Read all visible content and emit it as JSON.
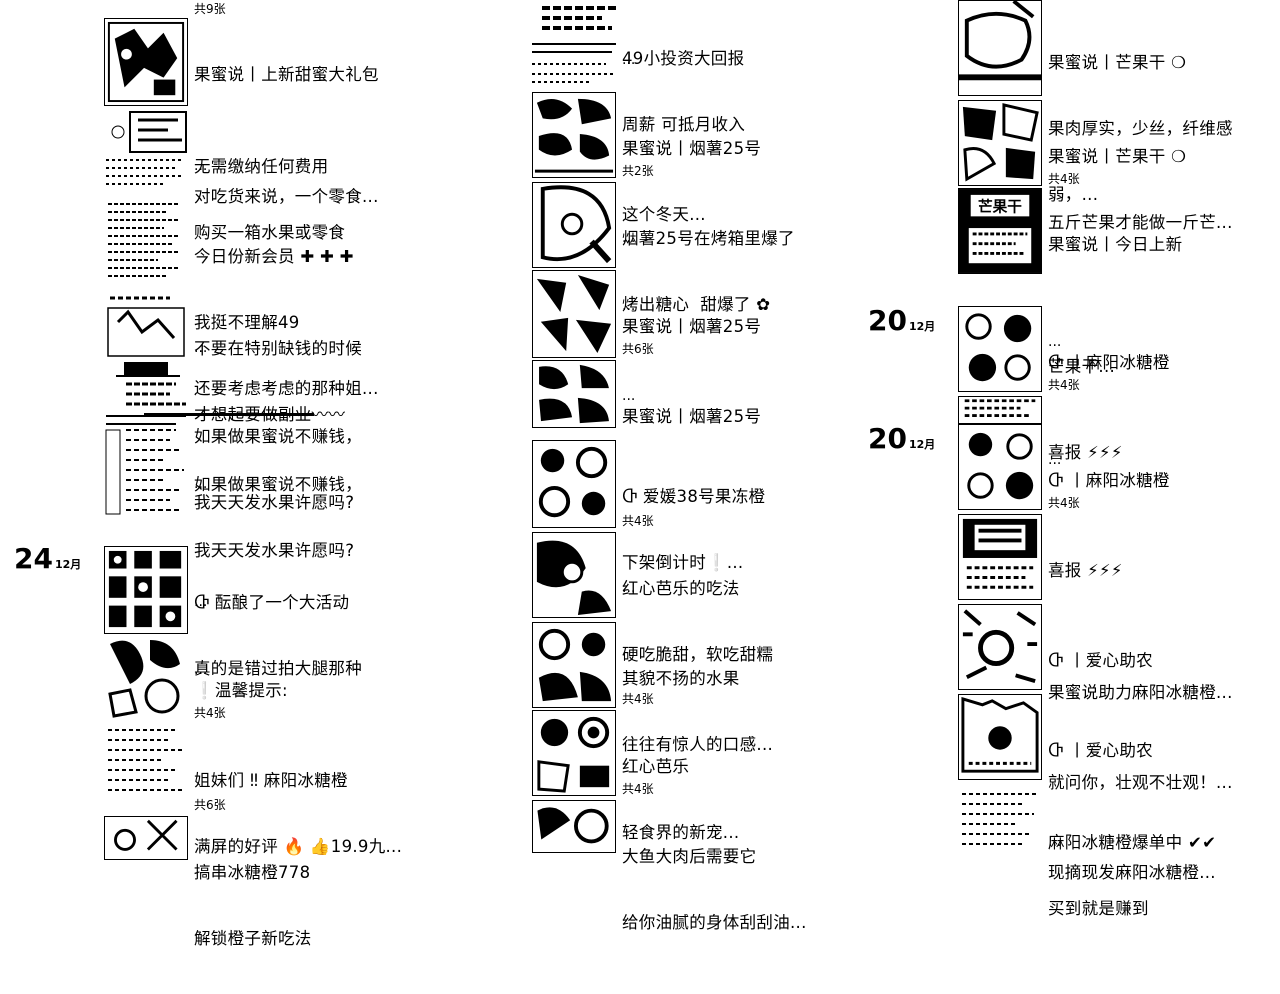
{
  "columns": [
    {
      "entries": [
        {
          "count_above": "共9张",
          "lines": [
            "果蜜说丨上新甜蜜大礼包",
            "",
            "对吃货来说，一个零食..."
          ],
          "show_ellipsis": false
        },
        {
          "lines": [
            "无需缴纳任何费用",
            "购买一箱水果或零食"
          ],
          "show_ellipsis": true
        },
        {
          "lines": [
            "今日份新会员 ✚ ✚ ✚",
            "我挺不理解49",
            "还要考虑考虑的那种姐..."
          ],
          "show_ellipsis": false
        },
        {
          "lines": [
            "不要在特别缺钱的时候",
            "才想起要做副业〰〰"
          ],
          "show_ellipsis": true
        },
        {
          "lines": [
            "如果做果蜜说不赚钱，",
            "我天天发水果许愿吗?"
          ],
          "show_ellipsis": false
        },
        {
          "lines": [
            "如果做果蜜说不赚钱，",
            "我天天发水果许愿吗?"
          ],
          "show_ellipsis": true
        },
        {
          "date_day": "24",
          "date_month": "12月",
          "lines": [
            "Ⴇ 酝酿了一个大活动",
            "真的是错过拍大腿那种"
          ],
          "show_ellipsis": true
        },
        {
          "lines": [
            "❕温馨提示:"
          ],
          "show_ellipsis": true
        },
        {
          "count_above": "共4张",
          "lines": [
            "姐妹们 ‼ 麻阳冰糖橙",
            "满屏的好评 🔥 👍19.9九..."
          ],
          "show_ellipsis": false
        },
        {
          "count_above": "共6张",
          "lines": [
            "搞串冰糖橙778",
            "解锁橙子新吃法"
          ],
          "show_ellipsis": false
        }
      ]
    },
    {
      "entries": [
        {
          "lines": [
            "49小投资大回报",
            "周薪 可抵月收入"
          ],
          "show_ellipsis": true
        },
        {
          "lines": [
            "果蜜说丨烟薯25号",
            "这个冬天..."
          ],
          "show_ellipsis": false
        },
        {
          "count_above": "共2张",
          "lines": [
            "烟薯25号在烤箱里爆了",
            "烤出糖心  甜爆了 ✿"
          ],
          "show_ellipsis": true
        },
        {
          "lines": [
            "果蜜说丨烟薯25号"
          ],
          "show_ellipsis": true
        },
        {
          "count_above": "共6张",
          "lines": [
            "果蜜说丨烟薯25号"
          ],
          "show_ellipsis": true
        },
        {
          "lines": [
            "Ⴇ 爱媛38号果冻橙",
            "下架倒计时❕..."
          ],
          "show_ellipsis": false
        },
        {
          "count_above": "共4张",
          "lines": [
            "红心芭乐的吃法",
            "硬吃脆甜，软吃甜糯"
          ],
          "show_ellipsis": true
        },
        {
          "lines": [
            "其貌不扬的水果",
            "往往有惊人的口感..."
          ],
          "show_ellipsis": false
        },
        {
          "count_above": "共4张",
          "lines": [
            "红心芭乐",
            "轻食界的新宠..."
          ],
          "show_ellipsis": false
        },
        {
          "count_above": "共4张",
          "lines": [
            "大鱼大肉后需要它",
            "给你油腻的身体刮刮油..."
          ],
          "show_ellipsis": false
        }
      ]
    },
    {
      "entries": [
        {
          "lines": [
            "果蜜说丨芒果干 ❍",
            "果肉厚实，少丝，纤维感",
            "弱，..."
          ],
          "show_ellipsis": false
        },
        {
          "lines": [
            "果蜜说丨芒果干 ❍",
            "五斤芒果才能做一斤芒..."
          ],
          "show_ellipsis": false
        },
        {
          "count_above": "共4张",
          "lines": [
            "果蜜说丨今日上新",
            "",
            "芒果干..."
          ],
          "show_ellipsis": false
        },
        {
          "date_day": "20",
          "date_month": "12月",
          "lines": [
            "Ⴇ 丨麻阳冰糖橙"
          ],
          "show_ellipsis": true
        },
        {
          "count_above": "共4张",
          "lines": [
            "喜报 ⚡⚡⚡"
          ],
          "show_ellipsis": false
        },
        {
          "date_day": "20",
          "date_month": "12月",
          "lines": [
            "Ⴇ 丨麻阳冰糖橙"
          ],
          "show_ellipsis": true
        },
        {
          "count_above": "共4张",
          "lines": [
            "喜报 ⚡⚡⚡",
            "",
            "果蜜说助力麻阳冰糖橙..."
          ],
          "show_ellipsis": false
        },
        {
          "lines": [
            "Ⴇ 丨爱心助农",
            "",
            "就问你，壮观不壮观！..."
          ],
          "show_ellipsis": false
        },
        {
          "lines": [
            "Ⴇ 丨爱心助农",
            "",
            "现摘现发麻阳冰糖橙..."
          ],
          "show_ellipsis": false
        },
        {
          "lines": [
            "麻阳冰糖橙爆单中 ✔✔",
            "买到就是赚到"
          ],
          "show_ellipsis": true
        }
      ]
    }
  ],
  "ellipsis": "...",
  "thumb_caption": "芒果干"
}
